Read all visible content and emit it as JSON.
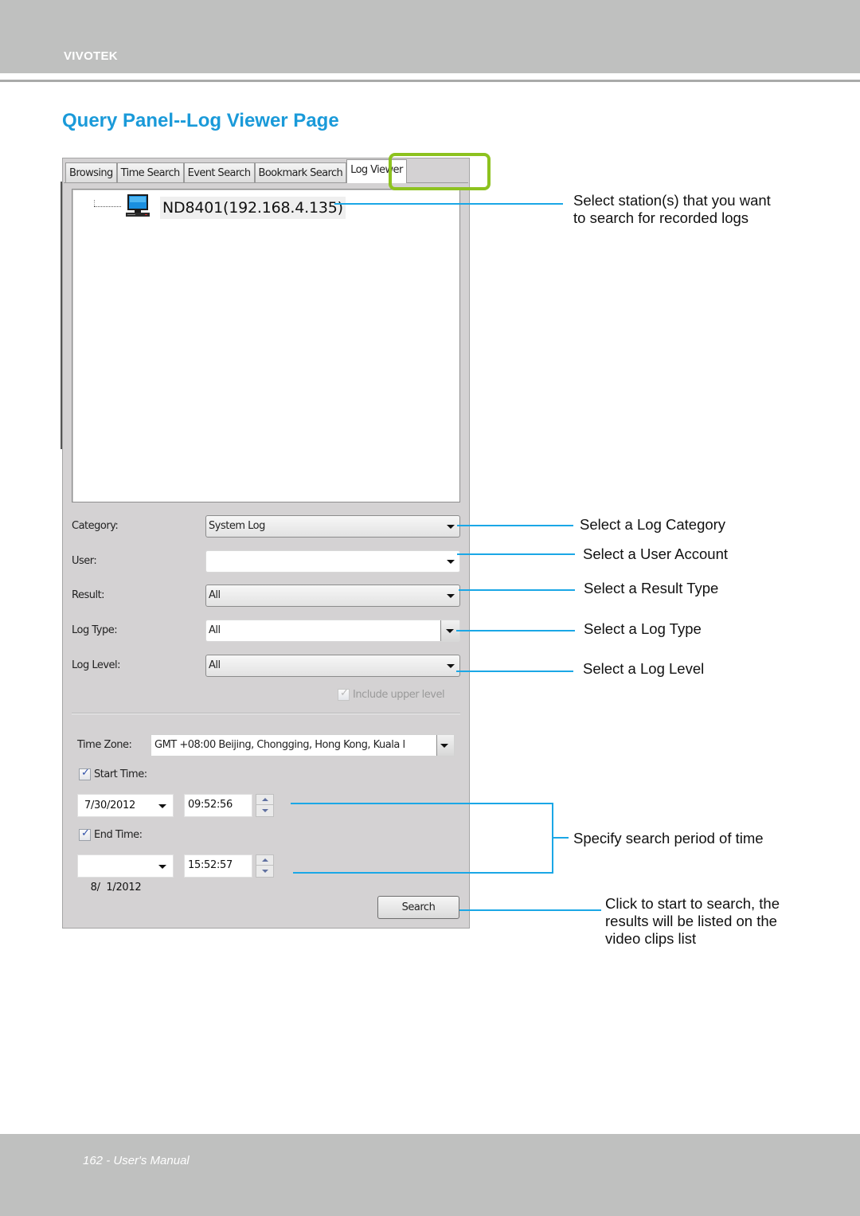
{
  "header": {
    "brand": "VIVOTEK"
  },
  "page_title": "Query Panel--Log Viewer Page",
  "screenshot": {
    "tabs": [
      {
        "label": "Browsing",
        "active": false
      },
      {
        "label": "Time Search",
        "active": false
      },
      {
        "label": "Event Search",
        "active": false
      },
      {
        "label": "Bookmark Search",
        "active": false
      },
      {
        "label": "Log Viewer",
        "active": true
      }
    ],
    "highlight_color": "#8dc21f",
    "tree": {
      "station_label": "ND8401(192.168.4.135)",
      "icon": "monitor-icon"
    },
    "fields": {
      "category": {
        "label": "Category:",
        "value": "System Log"
      },
      "user": {
        "label": "User:",
        "value": ""
      },
      "result": {
        "label": "Result:",
        "value": "All"
      },
      "log_type": {
        "label": "Log Type:",
        "value": "All"
      },
      "log_level": {
        "label": "Log Level:",
        "value": "All"
      }
    },
    "include_upper_level": {
      "label": "Include upper level",
      "checked": true,
      "enabled": false
    },
    "time_zone": {
      "label": "Time Zone:",
      "value": "GMT +08:00 Beijing, Chongging, Hong Kong, Kuala l"
    },
    "start_time": {
      "label": "Start Time:",
      "checked": true,
      "date": "7/30/2012",
      "time": "09:52:56"
    },
    "end_time": {
      "label": "End Time:",
      "checked": true,
      "date": "8/  1/2012",
      "time": "15:52:57"
    },
    "search_button": "Search"
  },
  "callouts": {
    "color": "#1aa7e6",
    "station": [
      "Select station(s) that you want",
      "to search for recorded logs"
    ],
    "category": "Select a Log Category",
    "user": "Select a User Account",
    "result": "Select a Result Type",
    "log_type": "Select a Log Type",
    "log_level": "Select a Log Level",
    "period": "Specify search period of time",
    "search": [
      "Click to start to search, the",
      "results will be listed on the",
      "video clips list"
    ]
  },
  "footer": {
    "text": "162 - User's Manual"
  }
}
